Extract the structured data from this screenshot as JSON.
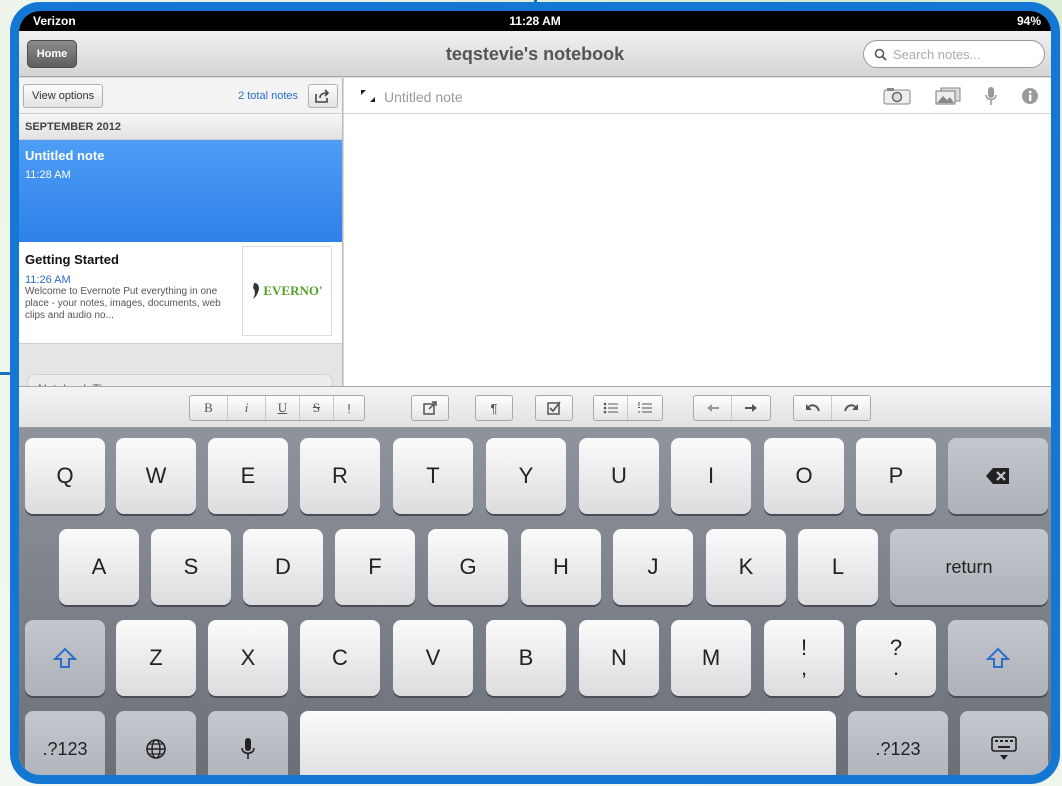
{
  "status_bar": {
    "carrier": "Verizon",
    "time": "11:28 AM",
    "battery": "94%"
  },
  "navbar": {
    "home_label": "Home",
    "title": "teqstevie's notebook",
    "search_placeholder": "Search notes..."
  },
  "sidebar": {
    "view_options_label": "View options",
    "total_notes": "2 total notes",
    "section_header": "SEPTEMBER 2012",
    "notes": [
      {
        "title": "Untitled note",
        "time": "11:28 AM"
      },
      {
        "title": "Getting Started",
        "time": "11:26 AM",
        "snippet": "Welcome to Evernote Put everything in one place - your notes, images, documents, web clips and audio no...",
        "thumb_text": "EVERNO'"
      }
    ],
    "notebook_tips": "Notebook Tips"
  },
  "editor": {
    "note_title_placeholder": "Untitled note"
  },
  "format_bar": {
    "bold": "B",
    "italic": "i",
    "underline": "U",
    "strike": "S",
    "highlight": "!",
    "pilcrow": "¶"
  },
  "keyboard": {
    "row1": [
      "Q",
      "W",
      "E",
      "R",
      "T",
      "Y",
      "U",
      "I",
      "O",
      "P"
    ],
    "row2": [
      "A",
      "S",
      "D",
      "F",
      "G",
      "H",
      "J",
      "K",
      "L"
    ],
    "row3": [
      "Z",
      "X",
      "C",
      "V",
      "B",
      "N",
      "M"
    ],
    "return_label": "return",
    "num_label": ".?123",
    "punct1_top": "!",
    "punct1_bottom": ",",
    "punct2_top": "?",
    "punct2_bottom": "."
  },
  "colors": {
    "accent": "#2f80e9",
    "frame": "#1577d4"
  }
}
